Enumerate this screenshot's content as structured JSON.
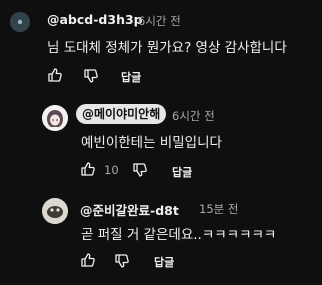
{
  "comments": [
    {
      "handle": "@abcd-d3h3p",
      "time": "6시간 전",
      "text": "님 도대체 정체가 뭔가요? 영상 감사합니다",
      "likes": "",
      "reply_label": "답글"
    },
    {
      "handle": "@메이야미안해",
      "time": "6시간 전",
      "text": "예빈이한테는 비밀입니다",
      "likes": "10",
      "reply_label": "답글",
      "is_creator": true
    },
    {
      "handle": "@준비갈완료-d8t",
      "time": "15분 전",
      "text": "곧 퍼질 거 같은데요..ㅋㅋㅋㅋㅋㅋ",
      "likes": "",
      "reply_label": "답글"
    }
  ],
  "colors": {
    "background": "#0f0f0f",
    "primary_text": "#f1f1f1",
    "secondary_text": "#aaaaaa",
    "creator_pill": "#e6e6e6"
  },
  "icons": [
    "thumbs-up-icon",
    "thumbs-down-icon"
  ]
}
